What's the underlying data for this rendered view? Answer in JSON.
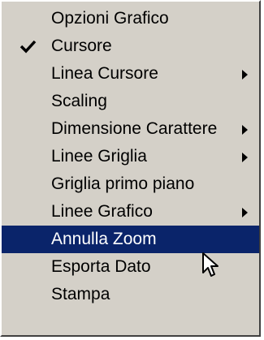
{
  "menu": {
    "items": [
      {
        "label": "Opzioni Grafico",
        "checked": false,
        "submenu": false,
        "active": false
      },
      {
        "label": "Cursore",
        "checked": true,
        "submenu": false,
        "active": false
      },
      {
        "label": "Linea Cursore",
        "checked": false,
        "submenu": true,
        "active": false
      },
      {
        "label": "Scaling",
        "checked": false,
        "submenu": false,
        "active": false
      },
      {
        "label": "Dimensione Carattere",
        "checked": false,
        "submenu": true,
        "active": false
      },
      {
        "label": "Linee Griglia",
        "checked": false,
        "submenu": true,
        "active": false
      },
      {
        "label": "Griglia primo piano",
        "checked": false,
        "submenu": false,
        "active": false
      },
      {
        "label": "Linee Grafico",
        "checked": false,
        "submenu": true,
        "active": false
      },
      {
        "label": "Annulla Zoom",
        "checked": false,
        "submenu": false,
        "active": true
      },
      {
        "label": "Esporta Dato",
        "checked": false,
        "submenu": false,
        "active": false
      },
      {
        "label": "Stampa",
        "checked": false,
        "submenu": false,
        "active": false
      }
    ]
  },
  "colors": {
    "menu_background": "#d4d0c8",
    "highlight": "#0a246a",
    "highlight_text": "#ffffff",
    "text": "#000000"
  },
  "icons": {
    "check": "check-icon",
    "submenu": "submenu-arrow-icon",
    "pointer": "mouse-pointer-icon"
  }
}
